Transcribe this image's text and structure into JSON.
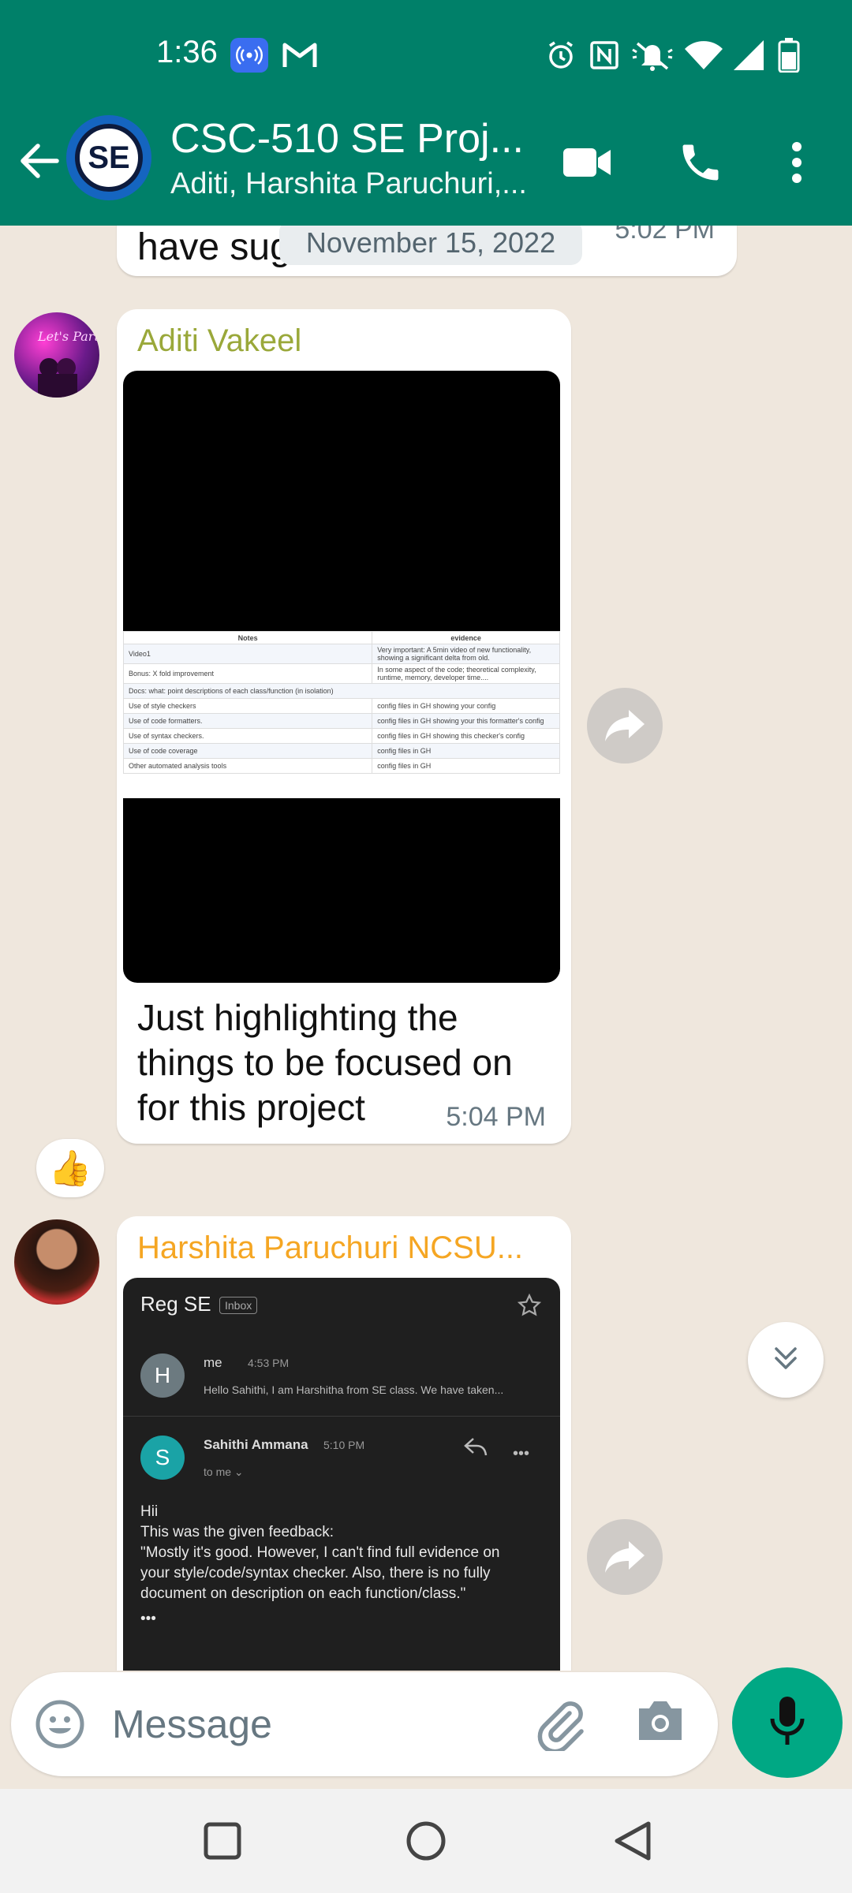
{
  "status_bar": {
    "time": "1:36",
    "icons": [
      "hotspot-icon",
      "gmail-icon",
      "alarm-icon",
      "nfc-icon",
      "mute-icon",
      "wifi-icon",
      "signal-icon",
      "battery-icon"
    ]
  },
  "header": {
    "title": "CSC-510 SE Proj...",
    "subtitle": "Aditi, Harshita Paruchuri,...",
    "avatar_text": "SE",
    "brand_color": "#008069"
  },
  "chat": {
    "previous_message": {
      "text_fragment": "have sug",
      "time": "5:02 PM"
    },
    "date_chip": "November 15, 2022",
    "messages": [
      {
        "sender": "Aditi Vakeel",
        "sender_color": "#9aa83a",
        "attachment": {
          "table_headers": [
            "Notes",
            "evidence"
          ],
          "table_rows": [
            [
              "Video1",
              "Very important: A 5min video of new functionality, showing a significant delta from old."
            ],
            [
              "Bonus: X fold improvement",
              "In some aspect of the code; theoretical complexity, runtime, memory, developer time...."
            ],
            [
              "Docs: what: point descriptions of each class/function (in isolation)",
              ""
            ],
            [
              "Use of style checkers",
              "config files in GH showing your config"
            ],
            [
              "Use of code formatters.",
              "config files in GH showing your this formatter's config"
            ],
            [
              "Use of syntax checkers.",
              "config files in GH showing this checker's config"
            ],
            [
              "Use of code coverage",
              "config files in GH"
            ],
            [
              "Other automated analysis tools",
              "config files in GH"
            ]
          ]
        },
        "caption": "Just highlighting the things to be focused on for this project",
        "time": "5:04 PM",
        "reaction": "👍"
      },
      {
        "sender": "Harshita Paruchuri NCSU...",
        "sender_color": "#f5a623",
        "email_screenshot": {
          "subject": "Reg SE",
          "badge": "Inbox",
          "first": {
            "initial": "H",
            "from": "me",
            "time": "4:53 PM",
            "snippet": "Hello Sahithi, I am Harshitha from SE class. We have taken..."
          },
          "second": {
            "initial": "S",
            "from": "Sahithi Ammana",
            "time": "5:10 PM",
            "to": "to me ⌄",
            "body_lines": [
              "Hii",
              "This was the given feedback:",
              "\"Mostly it's good. However, I can't find full evidence on",
              "your style/code/syntax checker. Also, there is no fully",
              "document on description on each function/class.\"",
              "•••"
            ]
          }
        }
      }
    ]
  },
  "composer": {
    "placeholder": "Message"
  }
}
